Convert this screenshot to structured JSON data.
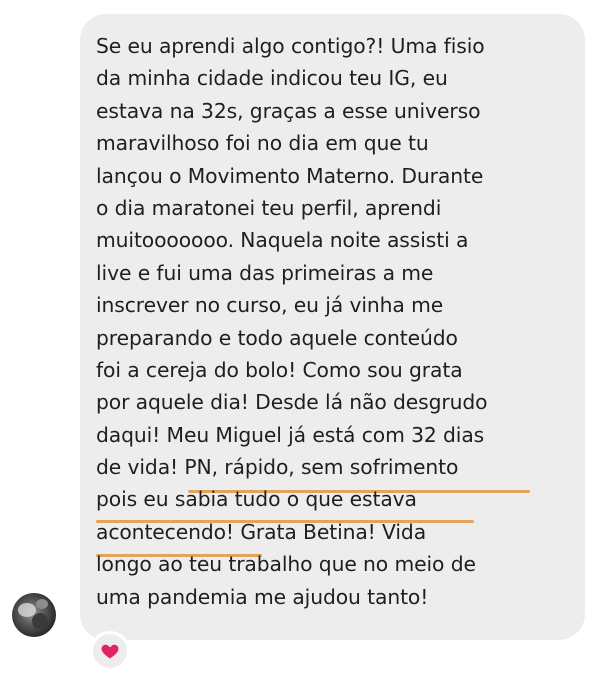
{
  "message": {
    "lines": [
      "Se eu aprendi algo contigo?! Uma fisio",
      "da minha cidade indicou teu IG, eu",
      "estava na 32s, graças a esse universo",
      "maravilhoso foi no dia em que tu",
      "lançou o Movimento Materno. Durante",
      "o dia maratonei teu perfil, aprendi",
      "muitooooooo. Naquela noite assisti a",
      "live e fui uma das primeiras a me",
      "inscrever no curso, eu já vinha me",
      "preparando e todo aquele conteúdo",
      "foi a cereja do bolo! Como sou grata",
      "por aquele dia! Desde lá não desgrudo",
      "daqui! Meu Miguel já está com 32 dias",
      "de vida! PN, rápido, sem sofrimento",
      "pois eu sabia tudo o que estava",
      "acontecendo! Grata Betina! Vida",
      "longo ao teu trabalho que no meio de",
      "uma pandemia me ajudou tanto!"
    ],
    "highlight_color": "#e3a35b",
    "bubble_color": "#ededed"
  },
  "reaction": {
    "icon": "heart-icon",
    "color": "#e0245e"
  },
  "sender": {
    "avatar": "avatar"
  }
}
